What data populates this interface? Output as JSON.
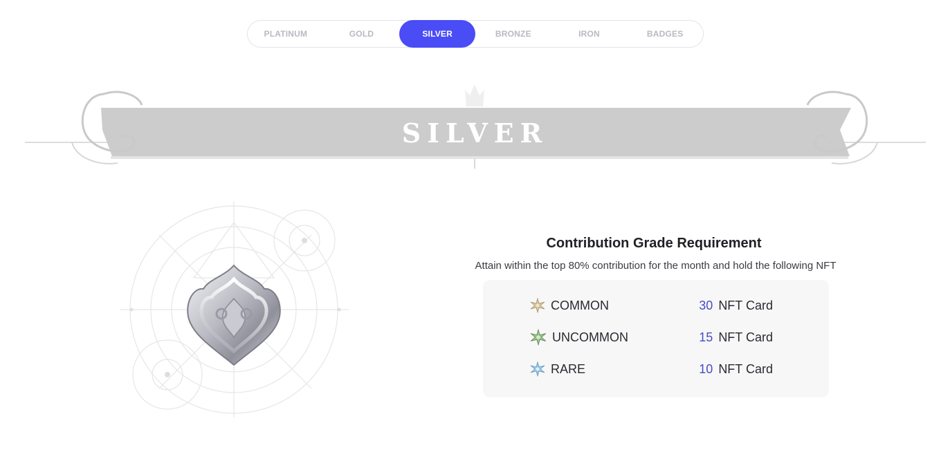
{
  "tabs": [
    {
      "label": "PLATINUM",
      "active": false
    },
    {
      "label": "GOLD",
      "active": false
    },
    {
      "label": "SILVER",
      "active": true
    },
    {
      "label": "BRONZE",
      "active": false
    },
    {
      "label": "IRON",
      "active": false
    },
    {
      "label": "BADGES",
      "active": false
    }
  ],
  "colors": {
    "accent": "#4a4cf6",
    "count_number": "#4a4cc8",
    "card_background": "#f7f7f8"
  },
  "banner": {
    "title": "SILVER"
  },
  "emblem": {
    "icon": "silver-tier-emblem-icon"
  },
  "requirement": {
    "title": "Contribution Grade Requirement",
    "subtitle": "Attain within the top 80% contribution for the month and hold the following NFT",
    "items": [
      {
        "icon": "common-star-icon",
        "rarity": "COMMON",
        "count": "30",
        "unit": "NFT Card"
      },
      {
        "icon": "uncommon-star-icon",
        "rarity": "UNCOMMON",
        "count": "15",
        "unit": "NFT Card"
      },
      {
        "icon": "rare-star-icon",
        "rarity": "RARE",
        "count": "10",
        "unit": "NFT Card"
      }
    ]
  }
}
